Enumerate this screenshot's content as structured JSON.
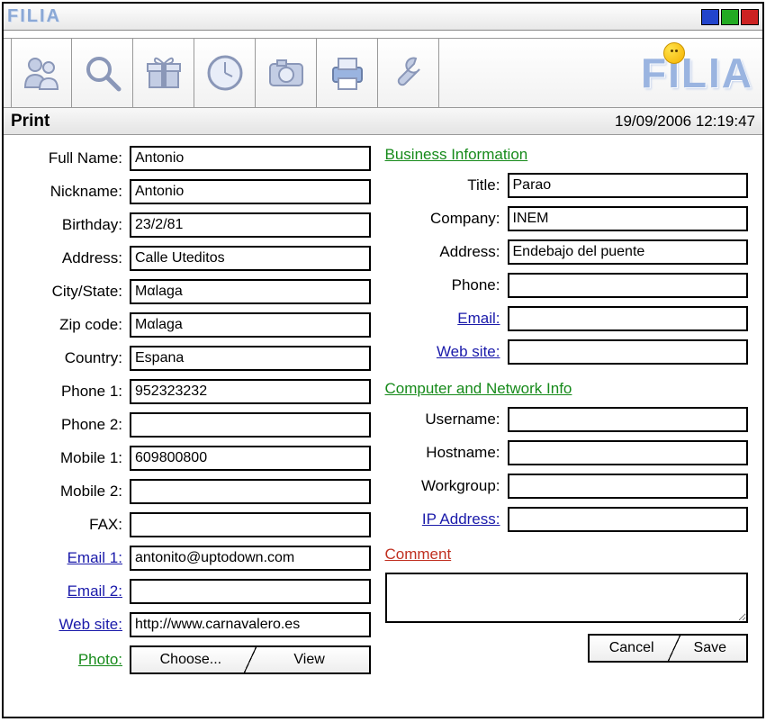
{
  "titlebar": {
    "logo": "FILIA"
  },
  "toolbar": {
    "brand": "FILIA"
  },
  "status": {
    "label": "Print",
    "datetime": "19/09/2006 12:19:47"
  },
  "left": {
    "fullname_lbl": "Full Name:",
    "fullname": "Antonio",
    "nickname_lbl": "Nickname:",
    "nickname": "Antonio",
    "birthday_lbl": "Birthday:",
    "birthday": "23/2/81",
    "address_lbl": "Address:",
    "address": "Calle Uteditos",
    "citystate_lbl": "City/State:",
    "citystate": "Mαlaga",
    "zip_lbl": "Zip code:",
    "zip": "Mαlaga",
    "country_lbl": "Country:",
    "country": "Espana",
    "phone1_lbl": "Phone 1:",
    "phone1": "952323232",
    "phone2_lbl": "Phone 2:",
    "phone2": "",
    "mobile1_lbl": "Mobile 1:",
    "mobile1": "609800800",
    "mobile2_lbl": "Mobile 2:",
    "mobile2": "",
    "fax_lbl": "FAX:",
    "fax": "",
    "email1_lbl": "Email 1:",
    "email1": "antonito@uptodown.com",
    "email2_lbl": "Email 2:",
    "email2": "",
    "website_lbl": "Web site:",
    "website": "http://www.carnavalero.es",
    "photo_lbl": "Photo:",
    "choose_btn": "Choose...",
    "view_btn": "View"
  },
  "right": {
    "biz_head": "Business Information",
    "title_lbl": "Title:",
    "title": "Parao",
    "company_lbl": "Company:",
    "company": "INEM",
    "address_lbl": "Address:",
    "address": "Endebajo del puente",
    "phone_lbl": "Phone:",
    "phone": "",
    "email_lbl": "Email:",
    "email": "",
    "website_lbl": "Web site:",
    "website": "",
    "net_head": "Computer and Network Info",
    "user_lbl": "Username:",
    "user": "",
    "host_lbl": "Hostname:",
    "host": "",
    "wg_lbl": "Workgroup:",
    "wg": "",
    "ip_lbl": "IP Address:",
    "ip": "",
    "comment_head": "Comment",
    "cancel_btn": "Cancel",
    "save_btn": "Save"
  }
}
